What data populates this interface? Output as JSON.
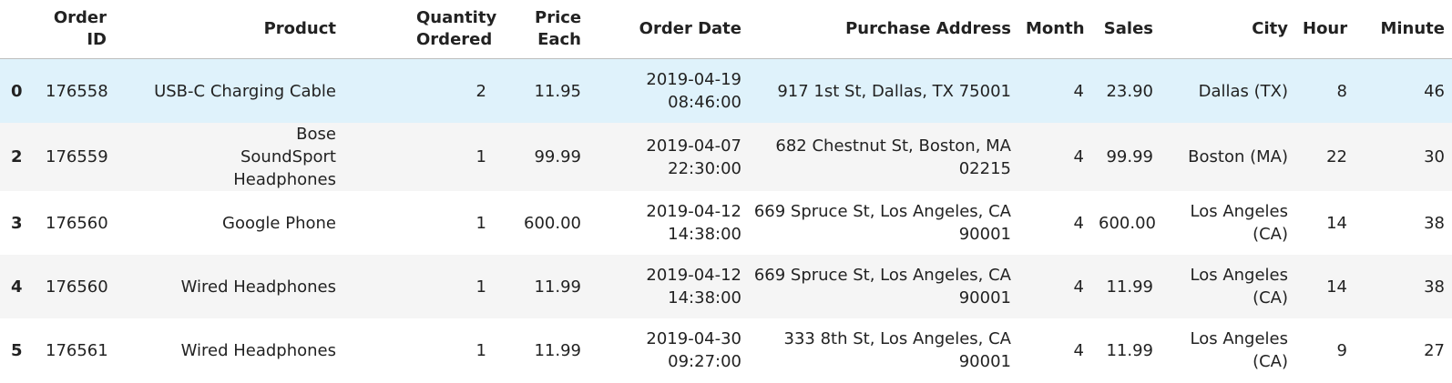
{
  "columns": {
    "index": "",
    "order_id": "Order ID",
    "product": "Product",
    "quantity": "Quantity Ordered",
    "price": "Price Each",
    "order_date": "Order Date",
    "address": "Purchase Address",
    "month": "Month",
    "sales": "Sales",
    "city": "City",
    "hour": "Hour",
    "minute": "Minute"
  },
  "rows": [
    {
      "index": "0",
      "order_id": "176558",
      "product": "USB-C Charging Cable",
      "quantity": "2",
      "price": "11.95",
      "order_date": "2019-04-19 08:46:00",
      "address": "917 1st St, Dallas, TX 75001",
      "month": "4",
      "sales": "23.90",
      "city": "Dallas (TX)",
      "hour": "8",
      "minute": "46"
    },
    {
      "index": "2",
      "order_id": "176559",
      "product": "Bose SoundSport Headphones",
      "quantity": "1",
      "price": "99.99",
      "order_date": "2019-04-07 22:30:00",
      "address": "682 Chestnut St, Boston, MA 02215",
      "month": "4",
      "sales": "99.99",
      "city": "Boston (MA)",
      "hour": "22",
      "minute": "30"
    },
    {
      "index": "3",
      "order_id": "176560",
      "product": "Google Phone",
      "quantity": "1",
      "price": "600.00",
      "order_date": "2019-04-12 14:38:00",
      "address": "669 Spruce St, Los Angeles, CA 90001",
      "month": "4",
      "sales": "600.00",
      "city": "Los Angeles (CA)",
      "hour": "14",
      "minute": "38"
    },
    {
      "index": "4",
      "order_id": "176560",
      "product": "Wired Headphones",
      "quantity": "1",
      "price": "11.99",
      "order_date": "2019-04-12 14:38:00",
      "address": "669 Spruce St, Los Angeles, CA 90001",
      "month": "4",
      "sales": "11.99",
      "city": "Los Angeles (CA)",
      "hour": "14",
      "minute": "38"
    },
    {
      "index": "5",
      "order_id": "176561",
      "product": "Wired Headphones",
      "quantity": "1",
      "price": "11.99",
      "order_date": "2019-04-30 09:27:00",
      "address": "333 8th St, Los Angeles, CA 90001",
      "month": "4",
      "sales": "11.99",
      "city": "Los Angeles (CA)",
      "hour": "9",
      "minute": "27"
    }
  ],
  "colors": {
    "hover_row": "#dff2fb",
    "striped_row": "#f5f5f5",
    "header_border": "#bdbdbd"
  }
}
